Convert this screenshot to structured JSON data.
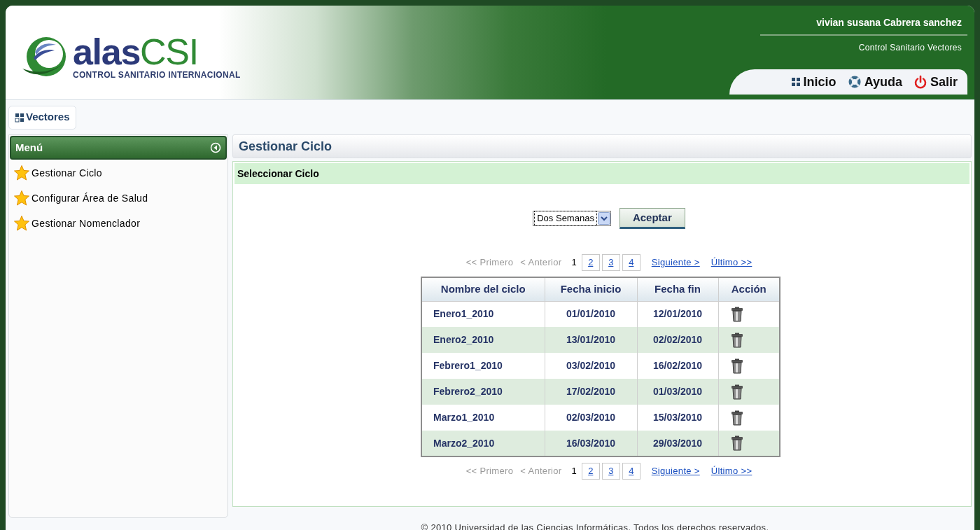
{
  "header": {
    "logo": {
      "name_a": "alas",
      "name_b": "CSI",
      "tagline": "CONTROL SANITARIO INTERNACIONAL"
    },
    "user": "vivian susana Cabrera sanchez",
    "system": "Control Sanitario Vectores",
    "nav": [
      {
        "label": "Inicio",
        "kind": "home"
      },
      {
        "label": "Ayuda",
        "kind": "help"
      },
      {
        "label": "Salir",
        "kind": "exit"
      }
    ]
  },
  "module_tab": {
    "label": "Vectores"
  },
  "sidebar": {
    "title": "Menú",
    "items": [
      {
        "label": "Gestionar Ciclo"
      },
      {
        "label": "Configurar Área de Salud"
      },
      {
        "label": "Gestionar Nomenclador"
      }
    ]
  },
  "main": {
    "title": "Gestionar Ciclo",
    "section": "Seleccionar Ciclo",
    "select": {
      "value": "Dos Semanas"
    },
    "accept_button": "Aceptar",
    "pager_top": [
      {
        "label": "<< Primero",
        "kind": "disabled"
      },
      {
        "label": "< Anterior",
        "kind": "disabled"
      },
      {
        "label": "1",
        "kind": "current"
      },
      {
        "label": "2",
        "kind": "page"
      },
      {
        "label": "3",
        "kind": "page"
      },
      {
        "label": "4",
        "kind": "page"
      },
      {
        "label": "Siguiente >",
        "kind": "link"
      },
      {
        "label": "Último >>",
        "kind": "link"
      }
    ],
    "table": {
      "columns": [
        "Nombre del ciclo",
        "Fecha inicio",
        "Fecha fin",
        "Acción"
      ],
      "rows": [
        [
          "Enero1_2010",
          "01/01/2010",
          "12/01/2010"
        ],
        [
          "Enero2_2010",
          "13/01/2010",
          "02/02/2010"
        ],
        [
          "Febrero1_2010",
          "03/02/2010",
          "16/02/2010"
        ],
        [
          "Febrero2_2010",
          "17/02/2010",
          "01/03/2010"
        ],
        [
          "Marzo1_2010",
          "02/03/2010",
          "15/03/2010"
        ],
        [
          "Marzo2_2010",
          "16/03/2010",
          "29/03/2010"
        ]
      ]
    },
    "pager_bottom": [
      {
        "label": "<< Primero",
        "kind": "disabled"
      },
      {
        "label": "< Anterior",
        "kind": "disabled"
      },
      {
        "label": "1",
        "kind": "current"
      },
      {
        "label": "2",
        "kind": "page"
      },
      {
        "label": "3",
        "kind": "page"
      },
      {
        "label": "4",
        "kind": "page"
      },
      {
        "label": "Siguiente >",
        "kind": "link"
      },
      {
        "label": "Último >>",
        "kind": "link"
      }
    ]
  },
  "footer": "© 2010 Universidad de las Ciencias Informáticas. Todos los derechos reservados."
}
